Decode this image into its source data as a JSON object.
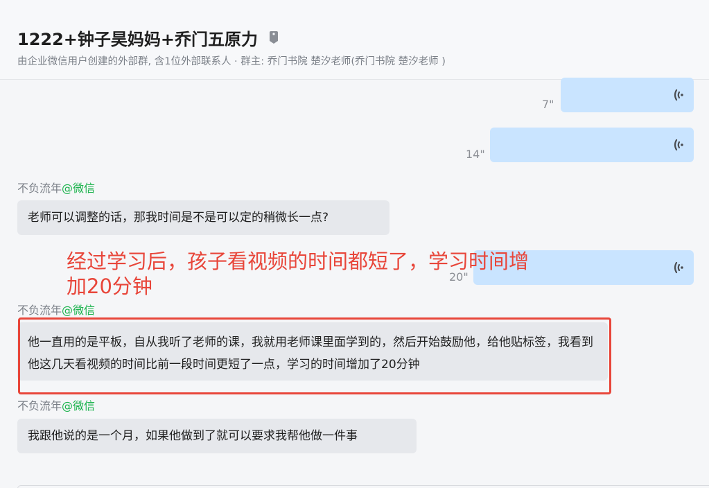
{
  "header": {
    "title": "1222+钟子昊妈妈+乔门五原力",
    "title_tag_icon": "tag-icon",
    "subtitle": "由企业微信用户创建的外部群, 含1位外部联系人 · 群主: 乔门书院 楚汐老师(乔门书院 楚汐老师 )"
  },
  "messages": [
    {
      "type": "voice",
      "direction": "outgoing",
      "duration": "7\"",
      "icon": "voice-wave-icon"
    },
    {
      "type": "voice",
      "direction": "outgoing",
      "duration": "14\"",
      "icon": "voice-wave-icon"
    },
    {
      "type": "text",
      "direction": "incoming",
      "sender_name": "不负流年",
      "sender_source": "@微信",
      "text": "老师可以调整的话，那我时间是不是可以定的稍微长一点?"
    },
    {
      "type": "voice",
      "direction": "outgoing",
      "duration": "20\"",
      "icon": "voice-wave-icon"
    },
    {
      "type": "text",
      "direction": "incoming",
      "sender_name": "不负流年",
      "sender_source": "@微信",
      "text": "他一直用的是平板，自从我听了老师的课，我就用老师课里面学到的，然后开始鼓励他，给他贴标签，我看到他这几天看视频的时间比前一段时间更短了一点，学习的时间增加了20分钟"
    },
    {
      "type": "text",
      "direction": "incoming",
      "sender_name": "不负流年",
      "sender_source": "@微信",
      "text": "我跟他说的是一个月，如果他做到了就可以要求我帮他做一件事"
    }
  ],
  "annotation": {
    "caption": "经过学习后，孩子看视频的时间都短了，学习时间增加20分钟"
  },
  "colors": {
    "outgoing_bubble": "#c9e4ff",
    "incoming_bubble": "#e6e8ec",
    "annotation_red": "#e8463a",
    "source_green": "#19b24b"
  }
}
